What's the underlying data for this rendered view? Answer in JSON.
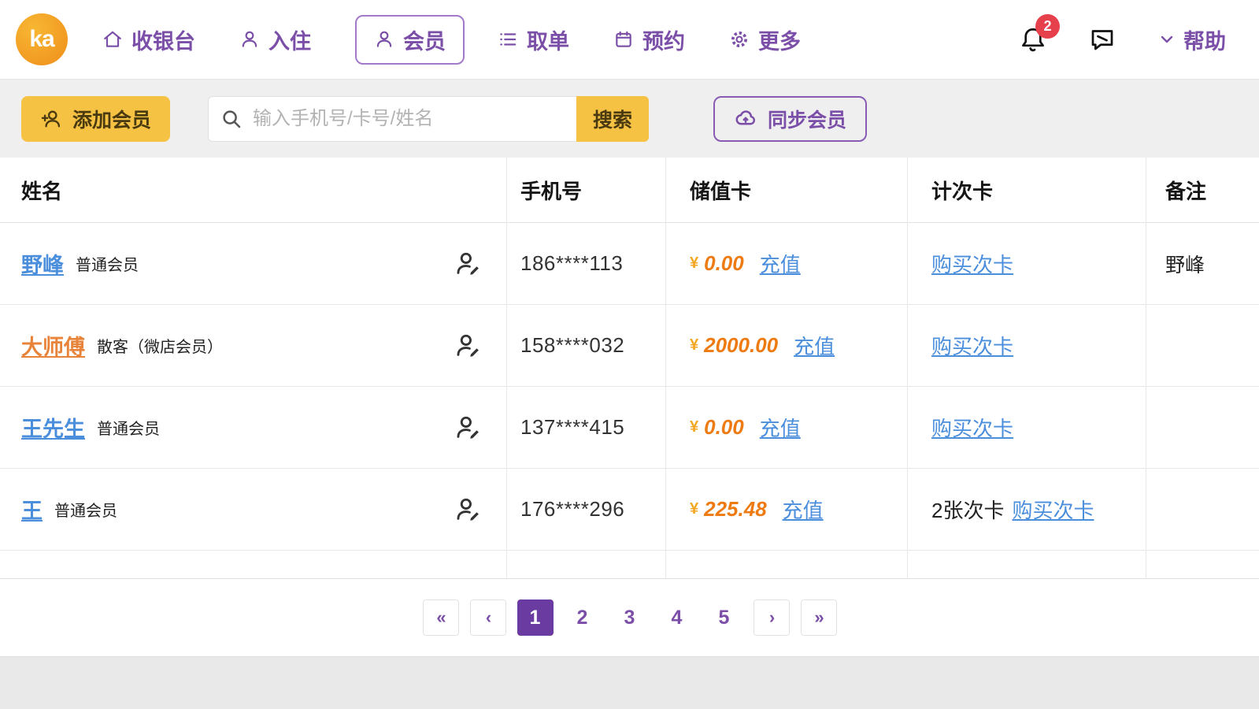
{
  "brand": {
    "logo_text": "ka"
  },
  "nav": {
    "items": [
      {
        "label": "收银台"
      },
      {
        "label": "入住"
      },
      {
        "label": "会员"
      },
      {
        "label": "取单"
      },
      {
        "label": "预约"
      },
      {
        "label": "更多"
      }
    ],
    "notification_count": "2",
    "help_label": "帮助"
  },
  "toolbar": {
    "add_member_label": "添加会员",
    "search_placeholder": "输入手机号/卡号/姓名",
    "search_button_label": "搜索",
    "sync_member_label": "同步会员"
  },
  "table": {
    "currency_symbol": "¥",
    "headers": {
      "name": "姓名",
      "phone": "手机号",
      "stored_card": "储值卡",
      "times_card": "计次卡",
      "note": "备注"
    },
    "rows": [
      {
        "name": "野峰",
        "tag": "普通会员",
        "phone": "186****113",
        "balance": "0.00",
        "recharge": "充值",
        "times_prefix": "",
        "times_card": "购买次卡",
        "note": "野峰"
      },
      {
        "name": "大师傅",
        "tag": "散客（微店会员）",
        "phone": "158****032",
        "balance": "2000.00",
        "recharge": "充值",
        "times_prefix": "",
        "times_card": "购买次卡",
        "note": ""
      },
      {
        "name": "王先生",
        "tag": "普通会员",
        "phone": "137****415",
        "balance": "0.00",
        "recharge": "充值",
        "times_prefix": "",
        "times_card": "购买次卡",
        "note": ""
      },
      {
        "name": "王",
        "tag": "普通会员",
        "phone": "176****296",
        "balance": "225.48",
        "recharge": "充值",
        "times_prefix": "2张次卡",
        "times_card": "购买次卡",
        "note": ""
      }
    ]
  },
  "pagination": {
    "first_label": "«",
    "prev_label": "‹",
    "pages": [
      "1",
      "2",
      "3",
      "4",
      "5"
    ],
    "active_page": "1",
    "next_label": "›",
    "last_label": "»"
  },
  "colors": {
    "purple": "#7B4FA8",
    "active_page_bg": "#6A3BA0",
    "yellow_button": "#F6C244",
    "blue_link": "#4A8EDC",
    "orange_amount": "#ED7B12",
    "orange_name": "#E8833A",
    "notification_badge": "#E6404D"
  }
}
